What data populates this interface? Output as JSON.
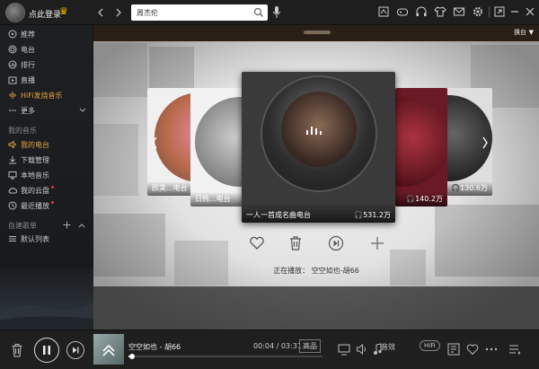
{
  "titlebar": {
    "login": "点此登录",
    "search_value": "周杰伦"
  },
  "sidebar": {
    "items": [
      {
        "label": "推荐",
        "icon": "disc-icon"
      },
      {
        "label": "电台",
        "icon": "radio-icon"
      },
      {
        "label": "排行",
        "icon": "chart-icon"
      },
      {
        "label": "直播",
        "icon": "live-icon"
      },
      {
        "label": "HiFi发烧音乐",
        "icon": "soundwave-icon",
        "active": true
      },
      {
        "label": "更多",
        "icon": "more-icon"
      }
    ],
    "my_music_title": "我的音乐",
    "my_music": [
      {
        "label": "我的电台",
        "icon": "speaker-icon",
        "active": true
      },
      {
        "label": "下载管理",
        "icon": "download-icon"
      },
      {
        "label": "本地音乐",
        "icon": "monitor-icon"
      },
      {
        "label": "我的云盘",
        "icon": "cloud-icon",
        "dot": true
      },
      {
        "label": "最近播放",
        "icon": "clock-icon",
        "dot": true
      }
    ],
    "playlist_title": "自建歌单",
    "playlists": [
      {
        "label": "默认列表",
        "icon": "list-icon"
      }
    ]
  },
  "main": {
    "switch_label": "换台",
    "cards": [
      {
        "title": "欧美...电台",
        "count": ""
      },
      {
        "title": "日韩...电台",
        "count": ""
      },
      {
        "title": "一人一首成名曲电台",
        "count": "531.2万"
      },
      {
        "title": "",
        "count": "140.2万"
      },
      {
        "title": "",
        "count": "130.6万"
      }
    ],
    "now_playing": "正在播放：  空空如也-胡66"
  },
  "player": {
    "song": "空空如也 - 胡66",
    "time": "00:04 / 03:31",
    "quality": "高品",
    "progress": 0.019,
    "sound_effect": "音效",
    "hifi": "HiFi"
  },
  "colors": {
    "accent": "#e6a23c",
    "titlebar": "#1e1e1e",
    "player": "#1f1f1f",
    "dot": "#e33333"
  }
}
